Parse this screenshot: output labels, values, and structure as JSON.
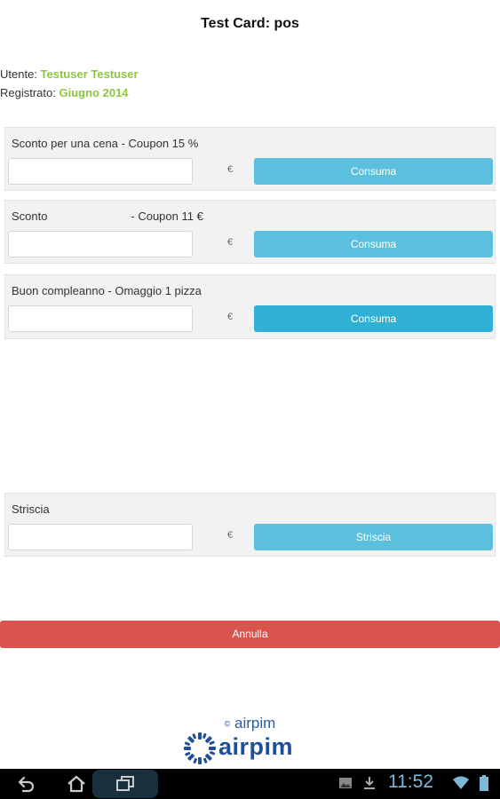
{
  "header": {
    "title": "Test Card: pos"
  },
  "user": {
    "name_label": "Utente:",
    "name_value": "Testuser Testuser",
    "registered_label": "Registrato:",
    "registered_value": "Giugno 2014"
  },
  "cards": [
    {
      "label": "Sconto per una cena - Coupon 15 %",
      "currency": "€",
      "button": "Consuma"
    },
    {
      "label": "Sconto                          - Coupon 11 €",
      "currency": "€",
      "button": "Consuma"
    },
    {
      "label": "Buon compleanno - Omaggio 1 pizza",
      "currency": "€",
      "button": "Consuma"
    }
  ],
  "swipe": {
    "label": "Striscia",
    "currency": "€",
    "button": "Striscia"
  },
  "cancel_label": "Annulla",
  "footer": {
    "copyright_symbol": "©",
    "copyright_text": "airpim",
    "logo_text": "airpim"
  },
  "statusbar": {
    "time": "11:52"
  },
  "colors": {
    "accent_green": "#8dc63f",
    "button_blue": "#5bc0de",
    "cancel_red": "#d9534f",
    "brand_blue": "#1f4f96"
  }
}
